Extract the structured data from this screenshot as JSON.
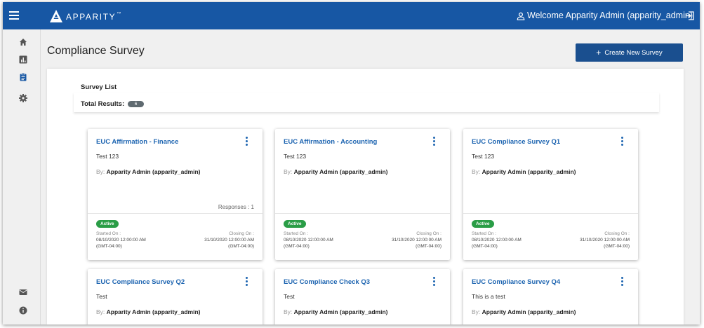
{
  "app": {
    "brand": "APPARITY",
    "trademark": "™",
    "welcome": "Welcome Apparity Admin (apparity_admin)"
  },
  "sidebar": {
    "icons": [
      "home-icon",
      "reports-icon",
      "surveys-icon",
      "settings-icon",
      "mail-icon",
      "info-icon"
    ]
  },
  "page": {
    "title": "Compliance Survey",
    "create_label": "Create New Survey",
    "create_plus": "+",
    "survey_list_label": "Survey List",
    "total_label": "Total Results:",
    "total_count": "6"
  },
  "cards": [
    {
      "title": "EUC Affirmation - Finance",
      "description": "Test 123",
      "by_label": "By:",
      "author": "Apparity Admin (apparity_admin)",
      "responses": "Responses : 1",
      "status": "Active",
      "started_label": "Started On :",
      "started_date": "08/10/2020 12:00:00 AM",
      "started_tz": "(GMT-04:00)",
      "closing_label": "Closing On :",
      "closing_date": "31/10/2020 12:00:00 AM",
      "closing_tz": "(GMT-04:00)"
    },
    {
      "title": "EUC Affirmation - Accounting",
      "description": "Test 123",
      "by_label": "By:",
      "author": "Apparity Admin (apparity_admin)",
      "status": "Active",
      "started_label": "Started On :",
      "started_date": "08/10/2020 12:00:00 AM",
      "started_tz": "(GMT-04:00)",
      "closing_label": "Closing On :",
      "closing_date": "31/10/2020 12:00:00 AM",
      "closing_tz": "(GMT-04:00)"
    },
    {
      "title": "EUC Compliance Survey Q1",
      "description": "Test 123",
      "by_label": "By:",
      "author": "Apparity Admin (apparity_admin)",
      "status": "Active",
      "started_label": "Started On :",
      "started_date": "08/10/2020 12:00:00 AM",
      "started_tz": "(GMT-04:00)",
      "closing_label": "Closing On :",
      "closing_date": "31/10/2020 12:00:00 AM",
      "closing_tz": "(GMT-04:00)"
    },
    {
      "title": "EUC Compliance Survey Q2",
      "description": "Test",
      "by_label": "By:",
      "author": "Apparity Admin (apparity_admin)"
    },
    {
      "title": "EUC Compliance Check Q3",
      "description": "Test",
      "by_label": "By:",
      "author": "Apparity Admin (apparity_admin)"
    },
    {
      "title": "EUC Compliance Survey Q4",
      "description": "This is a test",
      "by_label": "By:",
      "author": "Apparity Admin (apparity_admin)"
    }
  ],
  "colors": {
    "topbar": "#1757a4",
    "primary_button": "#1a4f8f",
    "link_title": "#1e65b1",
    "active_badge": "#2a9d46"
  }
}
